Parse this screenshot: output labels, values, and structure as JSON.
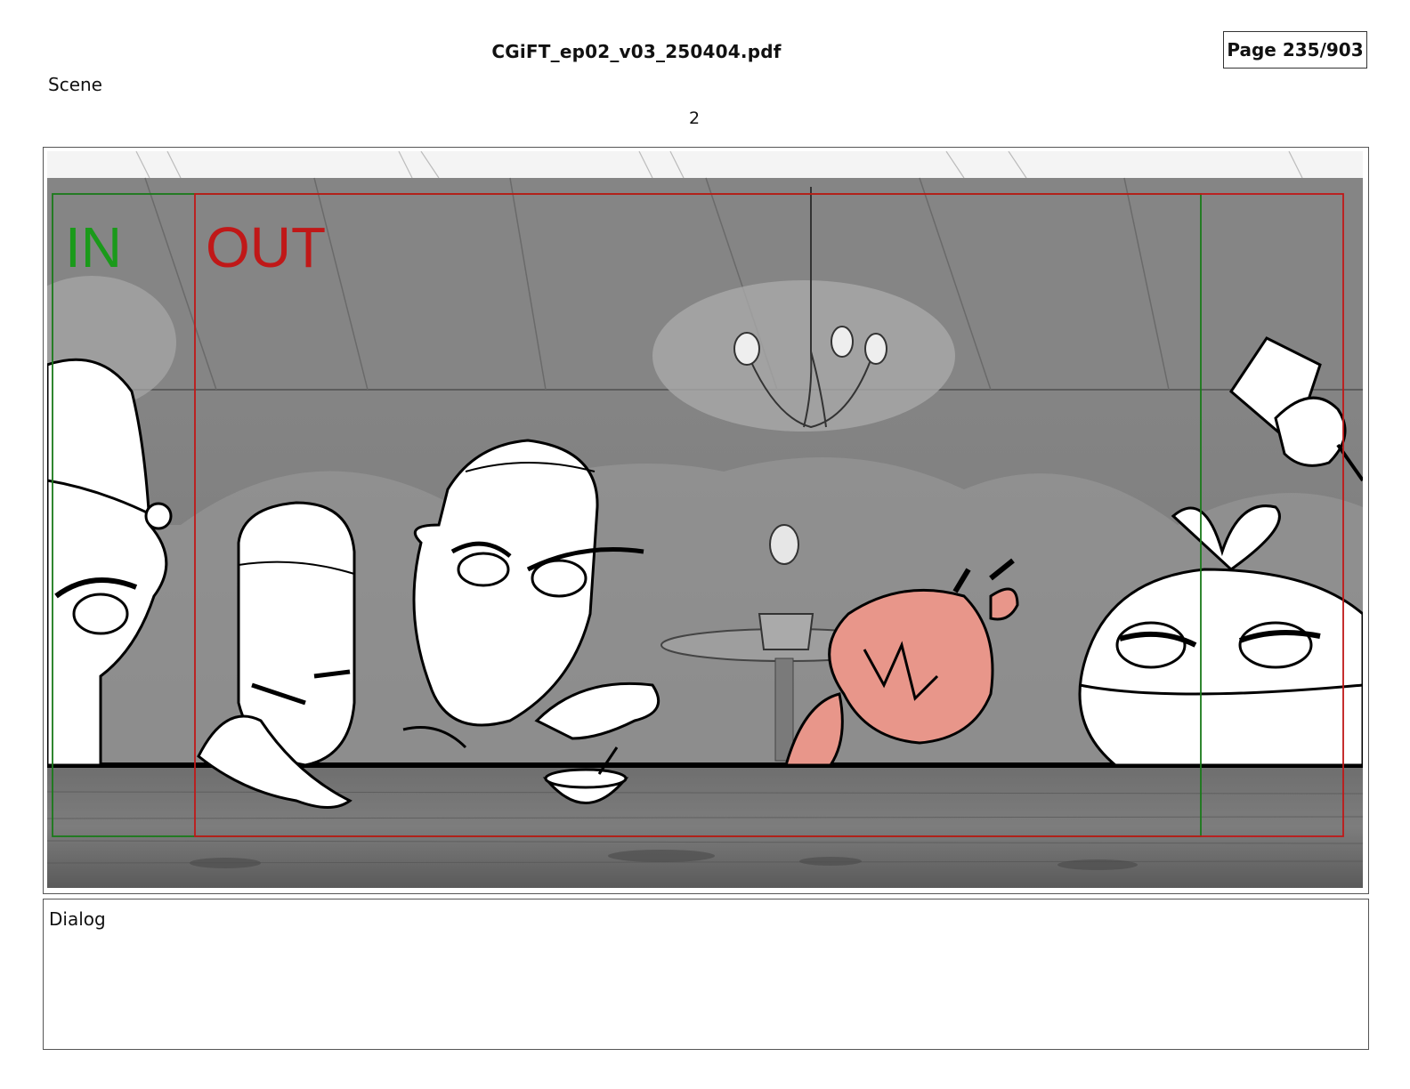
{
  "header": {
    "document_title": "CGiFT_ep02_v03_250404.pdf",
    "page_indicator": "Page 235/903"
  },
  "scene": {
    "label": "Scene",
    "number": "2"
  },
  "panel": {
    "in_marker": "IN",
    "out_marker": "OUT",
    "in_color": "#1a9a1a",
    "out_color": "#c01818",
    "highlight_character_color": "#e8968a"
  },
  "dialog": {
    "label": "Dialog"
  }
}
